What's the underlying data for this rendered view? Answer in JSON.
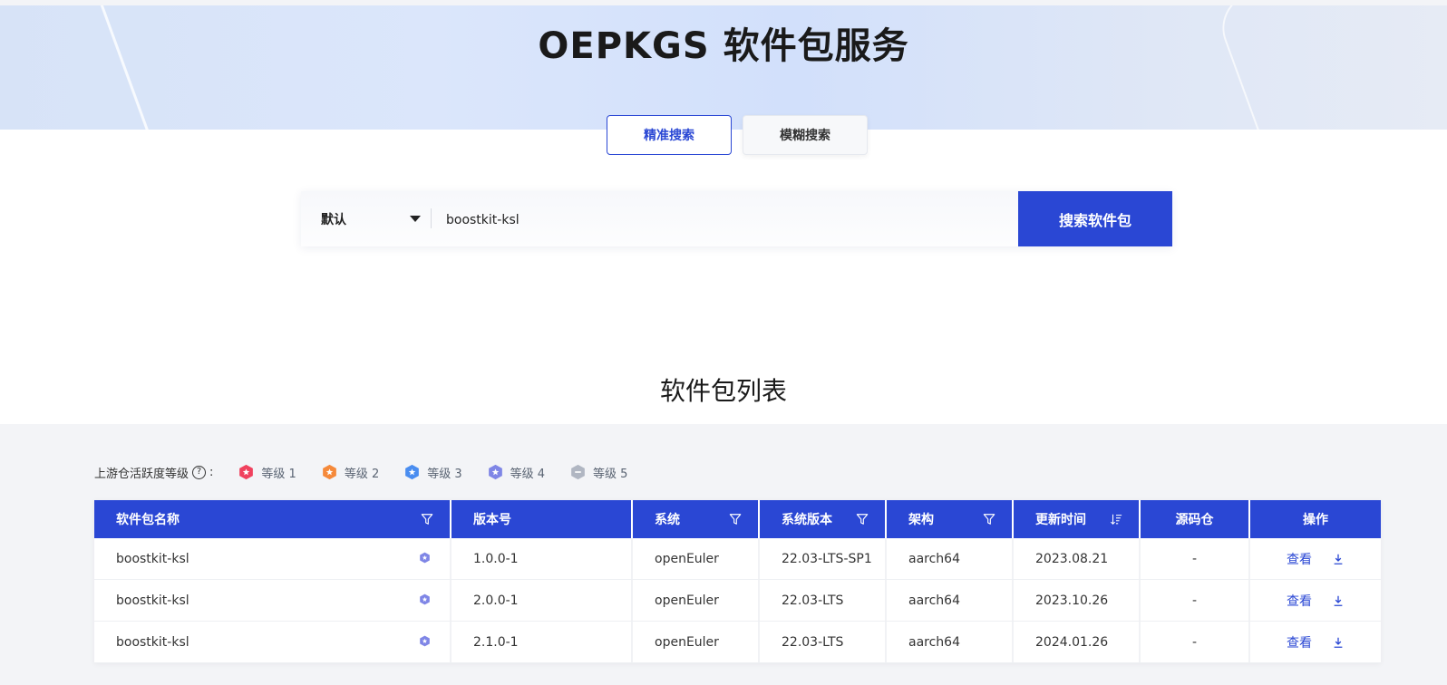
{
  "header": {
    "title": "OEPKGS 软件包服务"
  },
  "search_modes": {
    "exact": "精准搜索",
    "fuzzy": "模糊搜索",
    "active": "exact"
  },
  "search": {
    "scope_selected": "默认",
    "query": "boostkit-ksl",
    "button_label": "搜索软件包"
  },
  "list": {
    "title": "软件包列表",
    "level_label": "上游仓活跃度等级",
    "help_glyph": "?",
    "colon": ":",
    "levels": [
      {
        "label": "等级 1",
        "color": "#f0415e"
      },
      {
        "label": "等级 2",
        "color": "#f5893a"
      },
      {
        "label": "等级 3",
        "color": "#4a8df0"
      },
      {
        "label": "等级 4",
        "color": "#7f86e6"
      },
      {
        "label": "等级 5",
        "color": "#b0b6c2"
      }
    ]
  },
  "table": {
    "columns": [
      "软件包名称",
      "版本号",
      "系统",
      "系统版本",
      "架构",
      "更新时间",
      "源码仓",
      "操作"
    ],
    "rows": [
      {
        "name": "boostkit-ksl",
        "version": "1.0.0-1",
        "os": "openEuler",
        "os_version": "22.03-LTS-SP1",
        "arch": "aarch64",
        "updated": "2023.08.21",
        "source": "-",
        "action": "查看"
      },
      {
        "name": "boostkit-ksl",
        "version": "2.0.0-1",
        "os": "openEuler",
        "os_version": "22.03-LTS",
        "arch": "aarch64",
        "updated": "2023.10.26",
        "source": "-",
        "action": "查看"
      },
      {
        "name": "boostkit-ksl",
        "version": "2.1.0-1",
        "os": "openEuler",
        "os_version": "22.03-LTS",
        "arch": "aarch64",
        "updated": "2024.01.26",
        "source": "-",
        "action": "查看"
      }
    ]
  },
  "colors": {
    "primary": "#2a47d4",
    "level4_icon": "#7f86e6"
  }
}
